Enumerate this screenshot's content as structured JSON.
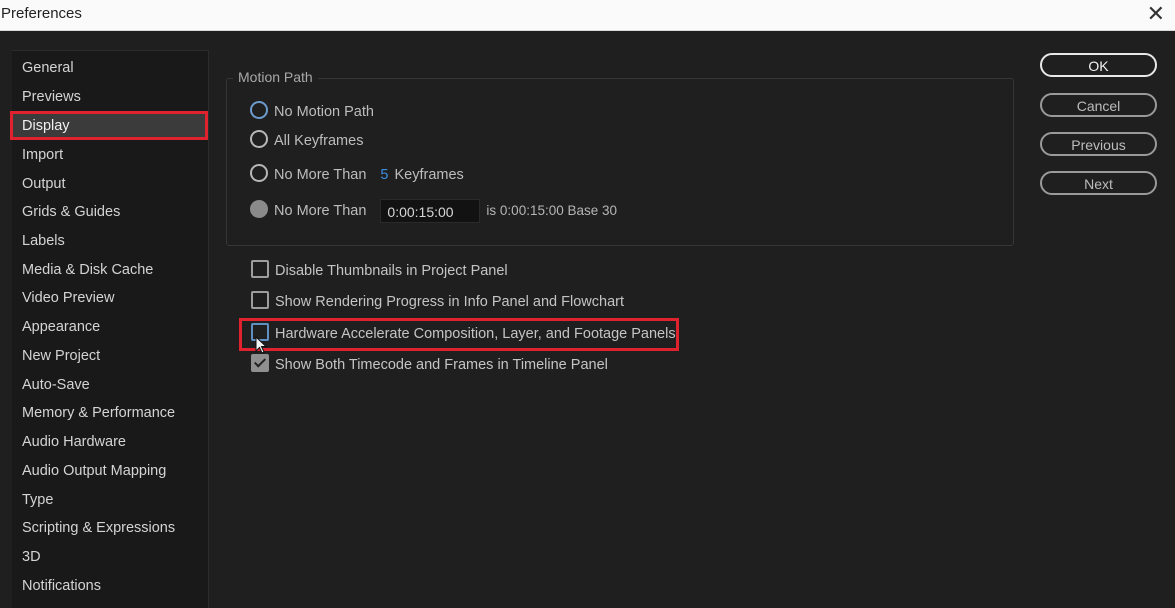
{
  "window": {
    "title": "Preferences"
  },
  "sidebar": {
    "items": [
      {
        "label": "General"
      },
      {
        "label": "Previews"
      },
      {
        "label": "Display",
        "selected": true
      },
      {
        "label": "Import"
      },
      {
        "label": "Output"
      },
      {
        "label": "Grids & Guides"
      },
      {
        "label": "Labels"
      },
      {
        "label": "Media & Disk Cache"
      },
      {
        "label": "Video Preview"
      },
      {
        "label": "Appearance"
      },
      {
        "label": "New Project"
      },
      {
        "label": "Auto-Save"
      },
      {
        "label": "Memory & Performance"
      },
      {
        "label": "Audio Hardware"
      },
      {
        "label": "Audio Output Mapping"
      },
      {
        "label": "Type"
      },
      {
        "label": "Scripting & Expressions"
      },
      {
        "label": "3D"
      },
      {
        "label": "Notifications"
      }
    ]
  },
  "motion_path": {
    "legend": "Motion Path",
    "options": {
      "none": {
        "label": "No Motion Path",
        "checked": true
      },
      "all": {
        "label": "All Keyframes",
        "checked": false
      },
      "keyframes": {
        "label": "No More Than",
        "value": "5",
        "unit": "Keyframes",
        "checked": false
      },
      "time": {
        "label": "No More Than",
        "value": "0:00:15:00",
        "info": "is 0:00:15:00  Base 30",
        "checked": false
      }
    }
  },
  "checkboxes": {
    "disable_thumbnails": {
      "label": "Disable Thumbnails in Project Panel",
      "checked": false
    },
    "show_rendering_progress": {
      "label": "Show Rendering Progress in Info Panel and Flowchart",
      "checked": false
    },
    "hardware_accelerate": {
      "label": "Hardware Accelerate Composition, Layer, and Footage Panels",
      "checked": false
    },
    "show_timecode_frames": {
      "label": "Show Both Timecode and Frames in Timeline Panel",
      "checked": true
    }
  },
  "buttons": {
    "ok": "OK",
    "cancel": "Cancel",
    "previous": "Previous",
    "next": "Next"
  },
  "colors": {
    "highlight": "#e0222e",
    "accent": "#3d8ee0",
    "background": "#1f1f1f"
  }
}
